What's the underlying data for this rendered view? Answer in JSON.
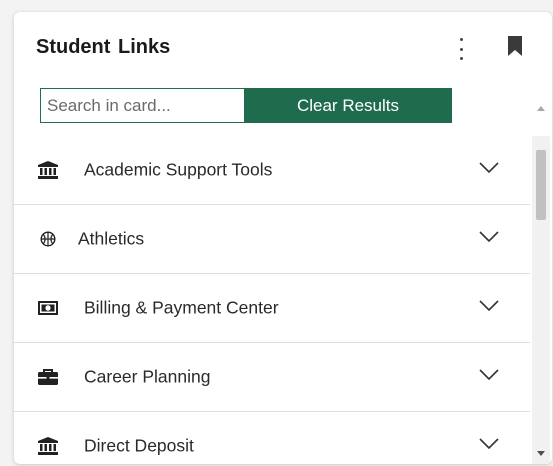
{
  "card": {
    "title": "Student Links",
    "menu_icon": "more-vertical-icon",
    "bookmark_icon": "bookmark-icon"
  },
  "search": {
    "placeholder": "Search in card...",
    "value": "",
    "clear_label": "Clear Results"
  },
  "items": [
    {
      "label": "Academic Support Tools",
      "icon": "institution-icon"
    },
    {
      "label": "Athletics",
      "icon": "basketball-icon"
    },
    {
      "label": "Billing & Payment Center",
      "icon": "money-bill-icon"
    },
    {
      "label": "Career Planning",
      "icon": "briefcase-icon"
    },
    {
      "label": "Direct Deposit",
      "icon": "institution-icon"
    }
  ],
  "colors": {
    "accent": "#1e6b4e",
    "card_bg": "#ffffff",
    "page_bg": "#f3f3f3"
  }
}
